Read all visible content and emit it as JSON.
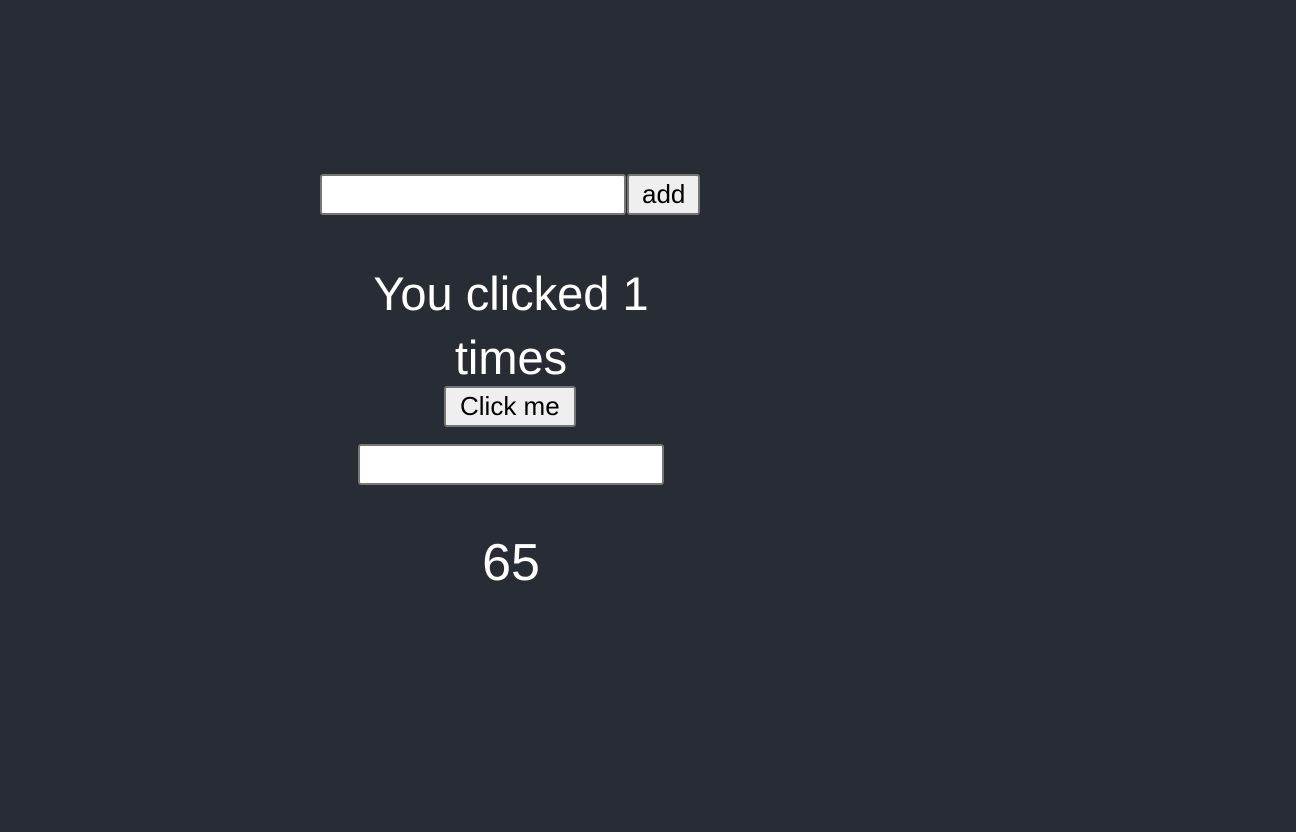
{
  "add_form": {
    "input_value": "",
    "input_placeholder": "",
    "button_label": "add"
  },
  "counter": {
    "message": "You clicked 1 times",
    "button_label": "Click me"
  },
  "second_input": {
    "value": "",
    "placeholder": ""
  },
  "number_display": "65",
  "colors": {
    "background": "#282c34",
    "text": "#ffffff",
    "button_bg": "#efefef",
    "border": "#767676"
  }
}
